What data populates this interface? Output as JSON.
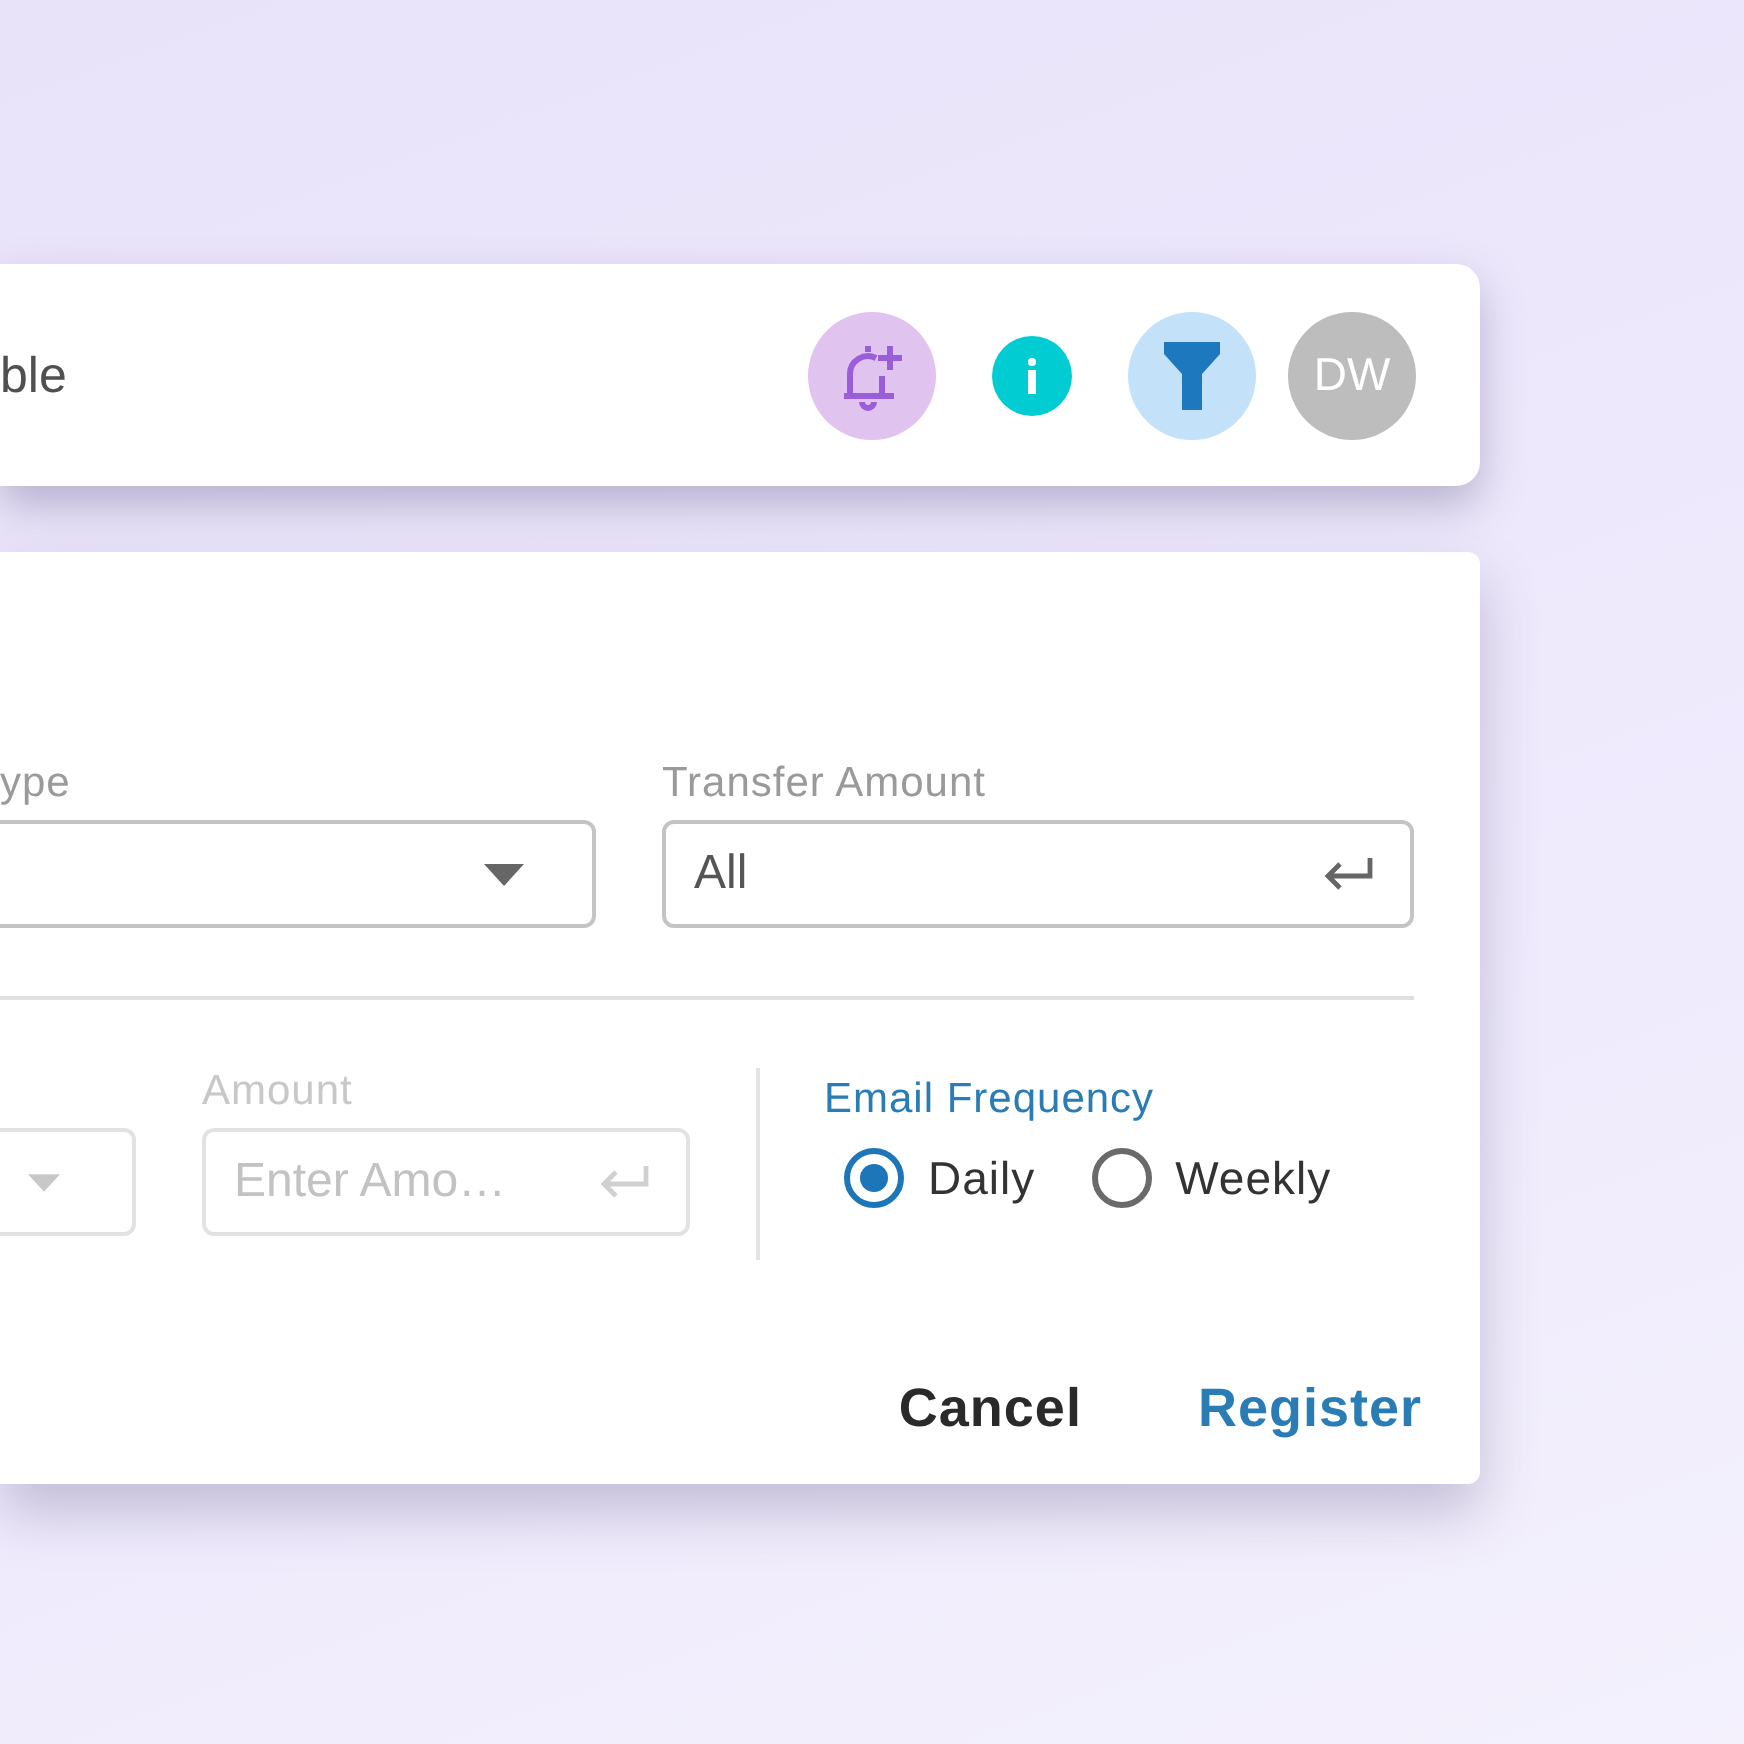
{
  "header": {
    "title": "ble",
    "avatar": "DW"
  },
  "form": {
    "fields": [
      {
        "kind": "select",
        "label": "ype"
      },
      {
        "kind": "text",
        "label": "Transfer Amount",
        "value": "All"
      }
    ],
    "filters": [
      {
        "kind": "select",
        "disabled": true
      },
      {
        "kind": "text",
        "label": "Amount",
        "placeholder": "Enter Amo…",
        "disabled": true
      }
    ],
    "email_frequency": {
      "label": "Email Frequency",
      "options": [
        {
          "label": "Daily",
          "selected": true
        },
        {
          "label": "Weekly",
          "selected": false
        }
      ]
    },
    "buttons": [
      {
        "label": "Cancel",
        "kind": "secondary"
      },
      {
        "label": "Register",
        "kind": "primary"
      }
    ]
  }
}
